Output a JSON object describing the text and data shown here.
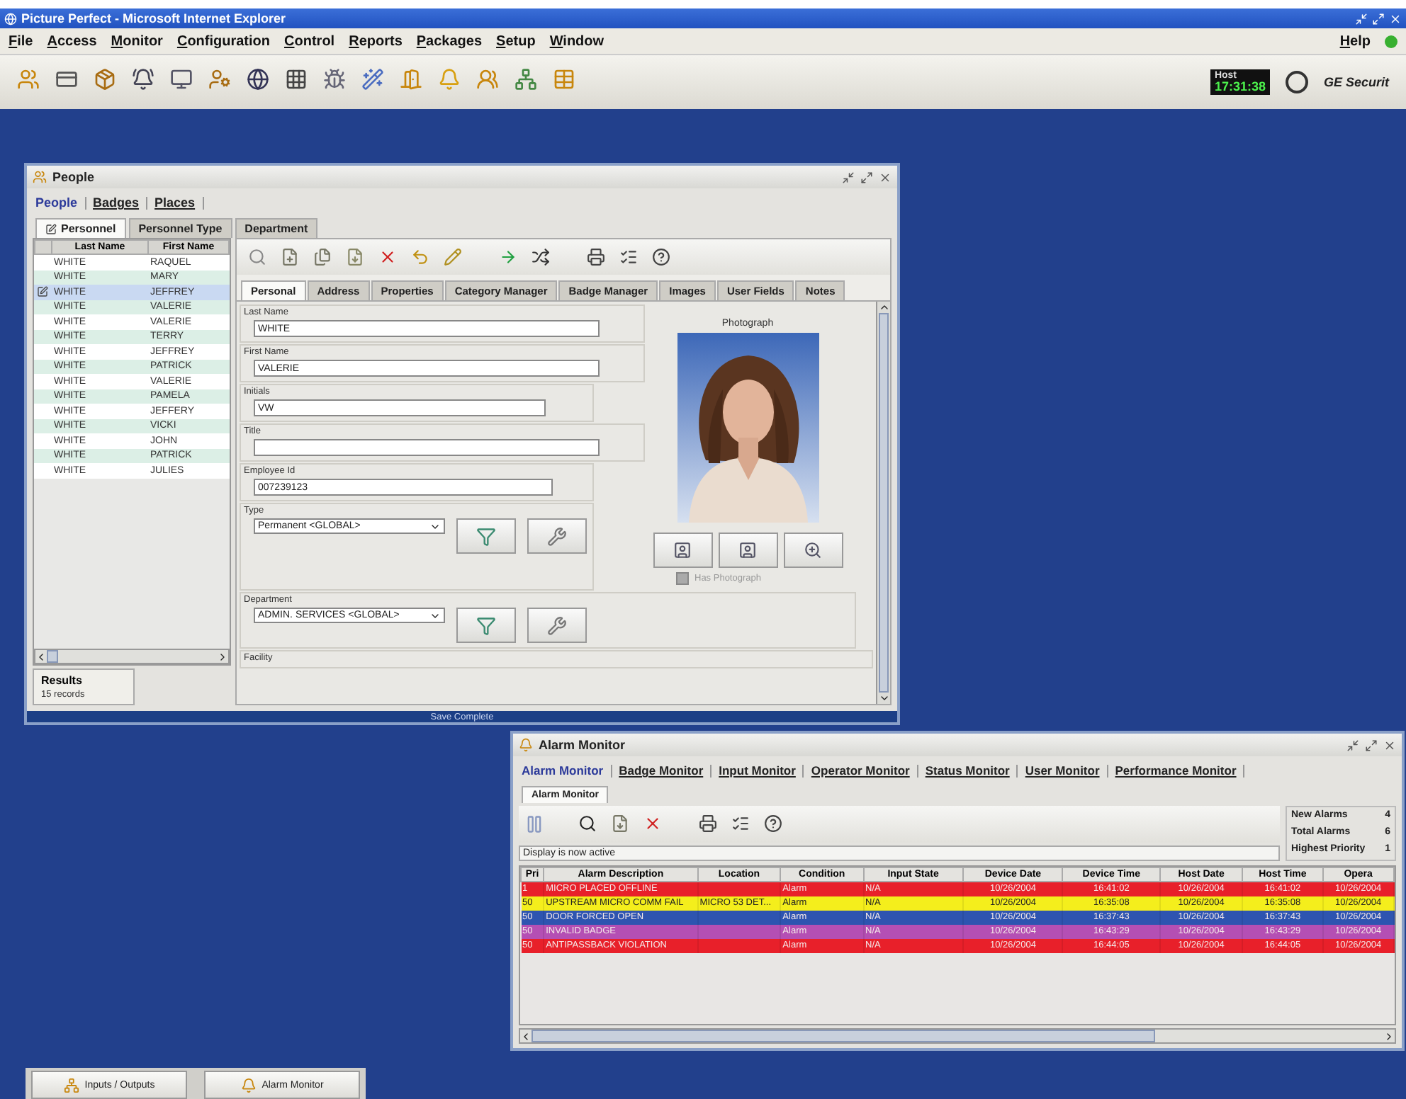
{
  "window": {
    "title": "Picture Perfect - Microsoft Internet Explorer"
  },
  "menu": [
    {
      "label": "File"
    },
    {
      "label": "Access"
    },
    {
      "label": "Monitor"
    },
    {
      "label": "Configuration"
    },
    {
      "label": "Control"
    },
    {
      "label": "Reports"
    },
    {
      "label": "Packages"
    },
    {
      "label": "Setup"
    },
    {
      "label": "Window"
    }
  ],
  "help": "Help",
  "clock": {
    "label": "Host",
    "time": "17:31:38"
  },
  "brand": "GE Securit",
  "people_window": {
    "title": "People",
    "nav": [
      {
        "label": "People",
        "selected": true
      },
      {
        "label": "Badges",
        "selected": false
      },
      {
        "label": "Places",
        "selected": false
      }
    ],
    "tabs": [
      {
        "label": "Personnel",
        "selected": true
      },
      {
        "label": "Personnel Type",
        "selected": false
      },
      {
        "label": "Department",
        "selected": false
      }
    ],
    "list": {
      "columns": [
        "Last Name",
        "First Name"
      ],
      "rows": [
        {
          "last": "WHITE",
          "first": "RAQUEL",
          "selected": false
        },
        {
          "last": "WHITE",
          "first": "MARY",
          "selected": false
        },
        {
          "last": "WHITE",
          "first": "JEFFREY",
          "selected": true
        },
        {
          "last": "WHITE",
          "first": "VALERIE",
          "selected": false
        },
        {
          "last": "WHITE",
          "first": "VALERIE",
          "selected": false
        },
        {
          "last": "WHITE",
          "first": "TERRY",
          "selected": false
        },
        {
          "last": "WHITE",
          "first": "JEFFREY",
          "selected": false
        },
        {
          "last": "WHITE",
          "first": "PATRICK",
          "selected": false
        },
        {
          "last": "WHITE",
          "first": "VALERIE",
          "selected": false
        },
        {
          "last": "WHITE",
          "first": "PAMELA",
          "selected": false
        },
        {
          "last": "WHITE",
          "first": "JEFFERY",
          "selected": false
        },
        {
          "last": "WHITE",
          "first": "VICKI",
          "selected": false
        },
        {
          "last": "WHITE",
          "first": "JOHN",
          "selected": false
        },
        {
          "last": "WHITE",
          "first": "PATRICK",
          "selected": false
        },
        {
          "last": "WHITE",
          "first": "JULIES",
          "selected": false
        }
      ]
    },
    "results": {
      "title": "Results",
      "count": "15 records"
    },
    "detail_tabs": [
      {
        "label": "Personal",
        "selected": true
      },
      {
        "label": "Address",
        "selected": false
      },
      {
        "label": "Properties",
        "selected": false
      },
      {
        "label": "Category Manager",
        "selected": false
      },
      {
        "label": "Badge Manager",
        "selected": false
      },
      {
        "label": "Images",
        "selected": false
      },
      {
        "label": "User Fields",
        "selected": false
      },
      {
        "label": "Notes",
        "selected": false
      }
    ],
    "fields": [
      {
        "label": "Last Name",
        "value": "WHITE",
        "kind": "text"
      },
      {
        "label": "First Name",
        "value": "VALERIE",
        "kind": "text"
      },
      {
        "label": "Initials",
        "value": "VW",
        "kind": "text"
      },
      {
        "label": "Title",
        "kind": "text"
      },
      {
        "label": "Employee Id",
        "value": "007239123",
        "kind": "text"
      },
      {
        "label": "Type",
        "value": "Permanent <GLOBAL>",
        "kind": "select"
      },
      {
        "label": "Department",
        "value": "ADMIN. SERVICES <GLOBAL>",
        "kind": "select"
      },
      {
        "label": "Facility",
        "kind": "heading"
      }
    ],
    "photo": {
      "label": "Photograph",
      "has_photo_label": "Has Photograph",
      "checked": false,
      "disabled": true
    },
    "status": "Save Complete"
  },
  "alarm_window": {
    "title": "Alarm Monitor",
    "nav": [
      {
        "label": "Alarm Monitor",
        "selected": true
      },
      {
        "label": "Badge Monitor",
        "selected": false
      },
      {
        "label": "Input Monitor",
        "selected": false
      },
      {
        "label": "Operator Monitor",
        "selected": false
      },
      {
        "label": "Status Monitor",
        "selected": false
      },
      {
        "label": "User Monitor",
        "selected": false
      },
      {
        "label": "Performance Monitor",
        "selected": false
      }
    ],
    "tab": "Alarm Monitor",
    "counts": [
      {
        "label": "New Alarms",
        "value": "4"
      },
      {
        "label": "Total Alarms",
        "value": "6"
      },
      {
        "label": "Highest Priority",
        "value": "1"
      }
    ],
    "message": "Display is now active",
    "columns": [
      "Pri",
      "Alarm Description",
      "Location",
      "Condition",
      "Input State",
      "Device Date",
      "Device Time",
      "Host Date",
      "Host Time",
      "Opera"
    ],
    "rows": [
      {
        "cells": [
          "1",
          "MICRO PLACED OFFLINE",
          "",
          "Alarm",
          "N/A",
          "10/26/2004",
          "16:41:02",
          "10/26/2004",
          "16:41:02",
          "10/26/2004"
        ],
        "color": "#e8202a"
      },
      {
        "cells": [
          "50",
          "UPSTREAM MICRO COMM FAIL",
          "MICRO 53 DET...",
          "Alarm",
          "N/A",
          "10/26/2004",
          "16:35:08",
          "10/26/2004",
          "16:35:08",
          "10/26/2004"
        ],
        "color": "#f4ee1c"
      },
      {
        "cells": [
          "50",
          "DOOR FORCED OPEN",
          "",
          "Alarm",
          "N/A",
          "10/26/2004",
          "16:37:43",
          "10/26/2004",
          "16:37:43",
          "10/26/2004"
        ],
        "color": "#2e54b0"
      },
      {
        "cells": [
          "50",
          "INVALID BADGE",
          "",
          "Alarm",
          "N/A",
          "10/26/2004",
          "16:43:29",
          "10/26/2004",
          "16:43:29",
          "10/26/2004"
        ],
        "color": "#b44fb4"
      },
      {
        "cells": [
          "50",
          "ANTIPASSBACK VIOLATION",
          "",
          "Alarm",
          "N/A",
          "10/26/2004",
          "16:44:05",
          "10/26/2004",
          "16:44:05",
          "10/26/2004"
        ],
        "color": "#e8202a"
      }
    ]
  },
  "taskbar": [
    {
      "label": "Inputs / Outputs"
    },
    {
      "label": "Alarm Monitor"
    }
  ]
}
